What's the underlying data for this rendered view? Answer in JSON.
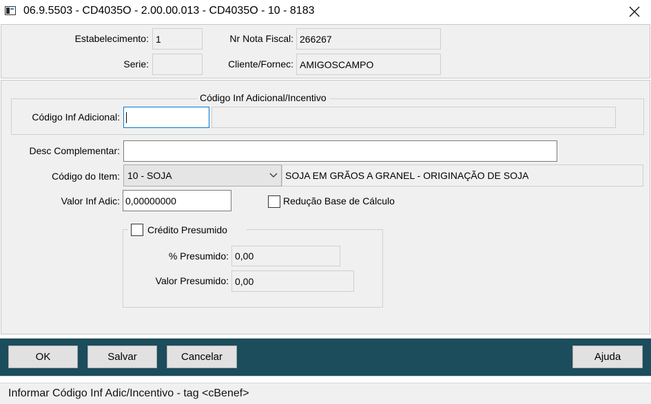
{
  "window": {
    "title": "06.9.5503 - CD4035O - 2.00.00.013 - CD4035O - 10 - 8183",
    "close_icon": "close-icon"
  },
  "header": {
    "estabelecimento_label": "Estabelecimento:",
    "estabelecimento_value": "1",
    "serie_label": "Serie:",
    "serie_value": "",
    "nr_nota_label": "Nr Nota Fiscal:",
    "nr_nota_value": "266267",
    "cliente_label": "Cliente/Fornec:",
    "cliente_value": "AMIGOSCAMPO"
  },
  "form": {
    "group_title": "Código Inf Adicional/Incentivo",
    "codigo_inf_label": "Código Inf Adicional:",
    "codigo_inf_value": "",
    "codigo_inf_desc": "",
    "desc_label": "Desc Complementar:",
    "desc_value": "",
    "item_label": "Código do Item:",
    "item_selected": "10 - SOJA",
    "item_desc": "SOJA EM GRÃOS A GRANEL - ORIGINAÇÃO DE SOJA",
    "valor_label": "Valor Inf Adic:",
    "valor_value": "0,00000000",
    "reducao_label": "Redução Base de Cálculo",
    "reducao_checked": false,
    "credito": {
      "title": "Crédito Presumido",
      "checked": false,
      "perc_label": "% Presumido:",
      "perc_value": "0,00",
      "valor_label": "Valor Presumido:",
      "valor_value": "0,00"
    }
  },
  "buttons": {
    "ok": "OK",
    "salvar": "Salvar",
    "cancelar": "Cancelar",
    "ajuda": "Ajuda"
  },
  "status": {
    "text": "Informar Código Inf Adic/Incentivo - tag <cBenef>"
  },
  "colors": {
    "bottom_bar": "#1b4d5c",
    "panel": "#f0f0f0",
    "focus_border": "#0078d7"
  }
}
